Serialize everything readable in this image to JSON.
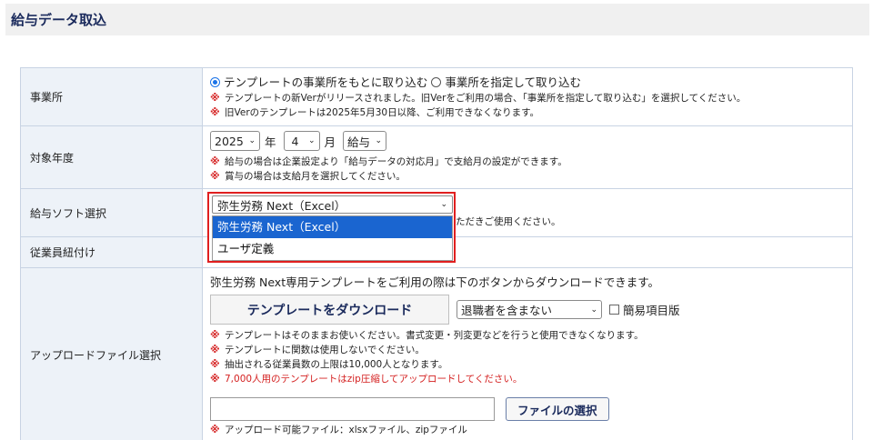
{
  "page": {
    "title": "給与データ取込"
  },
  "rows": {
    "jigyosho": {
      "label": "事業所",
      "radio1": "テンプレートの事業所をもとに取り込む",
      "radio2": "事業所を指定して取り込む",
      "note1": "テンプレートの新Verがリリースされました。旧Verをご利用の場合、「事業所を指定して取り込む」を選択してください。",
      "note2": "旧Verのテンプレートは2025年5月30日以降、ご利用できなくなります。"
    },
    "nendo": {
      "label": "対象年度",
      "year": "2025",
      "year_unit": "年",
      "month": "4",
      "month_unit": "月",
      "type": "給与",
      "note1": "給与の場合は企業設定より「給与データの対応月」で支給月の設定ができます。",
      "note2": "賞与の場合は支給月を選択してください。"
    },
    "soft": {
      "label": "給与ソフト選択",
      "selected": "弥生労務 Next（Excel）",
      "options": [
        "弥生労務 Next（Excel）",
        "ユーザ定義"
      ],
      "note_fragment": "ただきご使用ください。"
    },
    "kumi": {
      "label": "従業員紐付け"
    },
    "upload": {
      "label": "アップロードファイル選択",
      "intro": "弥生労務 Next専用テンプレートをご利用の際は下のボタンからダウンロードできます。",
      "download_button": "テンプレートをダウンロード",
      "retire_select": "退職者を含まない",
      "simple_checkbox": "簡易項目版",
      "notes": [
        "テンプレートはそのままお使いください。書式変更・列変更などを行うと使用できなくなります。",
        "テンプレートに関数は使用しないでください。",
        "抽出される従業員数の上限は10,000人となります。"
      ],
      "red_note": "7,000人用のテンプレートはzip圧縮してアップロードしてください。",
      "file_button": "ファイルの選択",
      "file_note": "アップロード可能ファイル：xlsxファイル、zipファイル"
    }
  },
  "mark": "※",
  "colors": {
    "accent": "#1a65d0",
    "highlight_border": "#e01f1f",
    "note_mark": "#d42020",
    "label_bg": "#edf2f8"
  }
}
